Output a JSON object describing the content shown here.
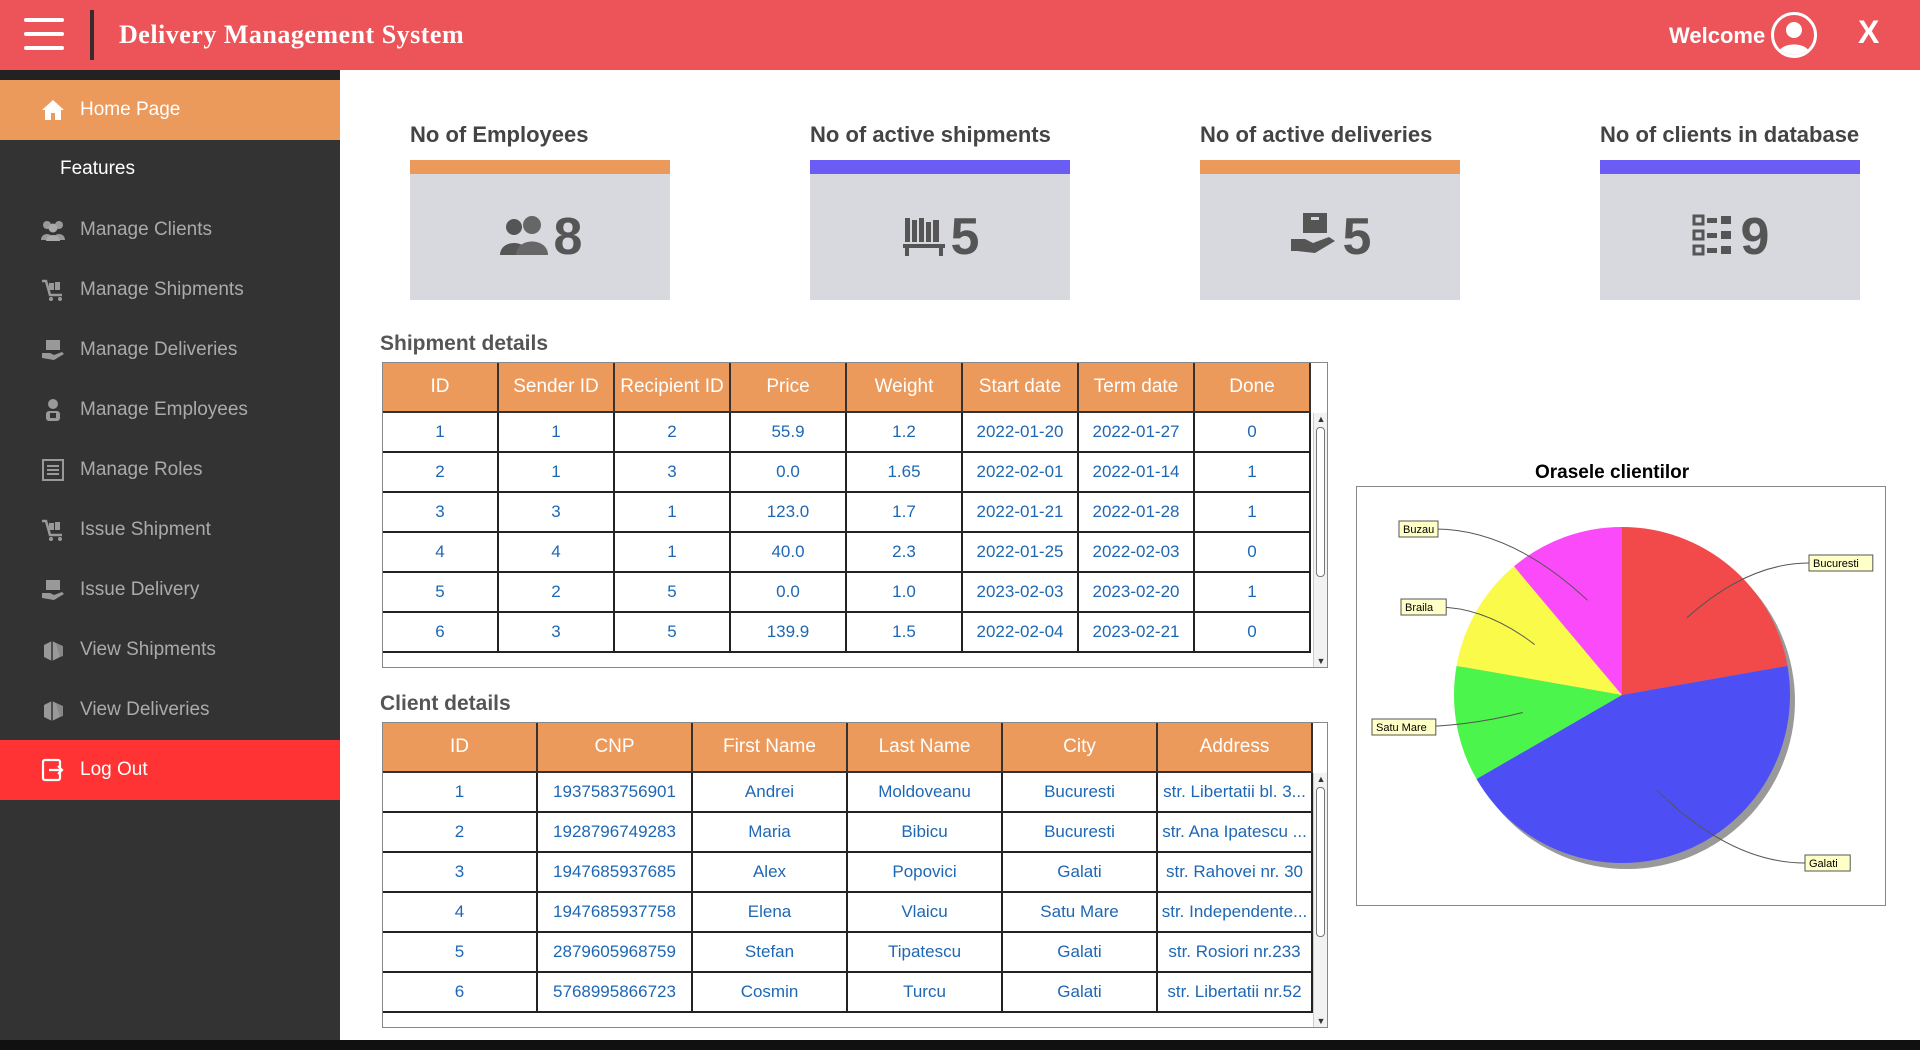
{
  "header": {
    "title": "Delivery Management System",
    "welcome": "Welcome",
    "close": "X"
  },
  "sidebar": {
    "items": [
      {
        "label": "Home Page",
        "icon": "home-icon"
      },
      {
        "label": "Features"
      },
      {
        "label": "Manage Clients",
        "icon": "users-icon"
      },
      {
        "label": "Manage Shipments",
        "icon": "cart-icon"
      },
      {
        "label": "Manage Deliveries",
        "icon": "delivery-icon"
      },
      {
        "label": "Manage Employees",
        "icon": "employee-icon"
      },
      {
        "label": "Manage Roles",
        "icon": "list-icon"
      },
      {
        "label": "Issue Shipment",
        "icon": "cart-icon"
      },
      {
        "label": "Issue Delivery",
        "icon": "delivery-icon"
      },
      {
        "label": "View Shipments",
        "icon": "boxes-icon"
      },
      {
        "label": "View Deliveries",
        "icon": "boxes-icon"
      },
      {
        "label": "Log Out",
        "icon": "logout-icon"
      }
    ]
  },
  "stats": [
    {
      "title": "No of Employees",
      "value": "8",
      "bar_color": "#ec9a5b",
      "icon": "group-icon"
    },
    {
      "title": "No of active shipments",
      "value": "5",
      "bar_color": "#6b5cf5",
      "icon": "shelf-icon"
    },
    {
      "title": "No of active deliveries",
      "value": "5",
      "bar_color": "#ec9a5b",
      "icon": "hand-box-icon"
    },
    {
      "title": "No of clients in database",
      "value": "9",
      "bar_color": "#6b5cf5",
      "icon": "checklist-icon"
    }
  ],
  "shipments": {
    "title": "Shipment details",
    "columns": [
      "ID",
      "Sender ID",
      "Recipient ID",
      "Price",
      "Weight",
      "Start date",
      "Term date",
      "Done"
    ],
    "rows": [
      [
        "1",
        "1",
        "2",
        "55.9",
        "1.2",
        "2022-01-20",
        "2022-01-27",
        "0"
      ],
      [
        "2",
        "1",
        "3",
        "0.0",
        "1.65",
        "2022-02-01",
        "2022-01-14",
        "1"
      ],
      [
        "3",
        "3",
        "1",
        "123.0",
        "1.7",
        "2022-01-21",
        "2022-01-28",
        "1"
      ],
      [
        "4",
        "4",
        "1",
        "40.0",
        "2.3",
        "2022-01-25",
        "2022-02-03",
        "0"
      ],
      [
        "5",
        "2",
        "5",
        "0.0",
        "1.0",
        "2023-02-03",
        "2023-02-20",
        "1"
      ],
      [
        "6",
        "3",
        "5",
        "139.9",
        "1.5",
        "2022-02-04",
        "2023-02-21",
        "0"
      ]
    ]
  },
  "clients": {
    "title": "Client details",
    "columns": [
      "ID",
      "CNP",
      "First Name",
      "Last Name",
      "City",
      "Address"
    ],
    "rows": [
      [
        "1",
        "1937583756901",
        "Andrei",
        "Moldoveanu",
        "Bucuresti",
        "str. Libertatii bl. 3..."
      ],
      [
        "2",
        "1928796749283",
        "Maria",
        "Bibicu",
        "Bucuresti",
        "str. Ana Ipatescu ..."
      ],
      [
        "3",
        "1947685937685",
        "Alex",
        "Popovici",
        "Galati",
        "str. Rahovei nr. 30"
      ],
      [
        "4",
        "1947685937758",
        "Elena",
        "Vlaicu",
        "Satu Mare",
        "str. Independente..."
      ],
      [
        "5",
        "2879605968759",
        "Stefan",
        "Tipatescu",
        "Galati",
        "str. Rosiori nr.233"
      ],
      [
        "6",
        "5768995866723",
        "Cosmin",
        "Turcu",
        "Galati",
        "str. Libertatii nr.52"
      ]
    ]
  },
  "chart_data": {
    "type": "pie",
    "title": "Orasele clientilor",
    "categories": [
      "Bucuresti",
      "Galati",
      "Satu Mare",
      "Braila",
      "Buzau"
    ],
    "values": [
      2,
      4,
      1,
      1,
      1
    ],
    "colors": [
      "#f24a4a",
      "#4d4ff5",
      "#4cf54c",
      "#fafa4a",
      "#fa4afa"
    ],
    "legend": "callout-labels"
  }
}
